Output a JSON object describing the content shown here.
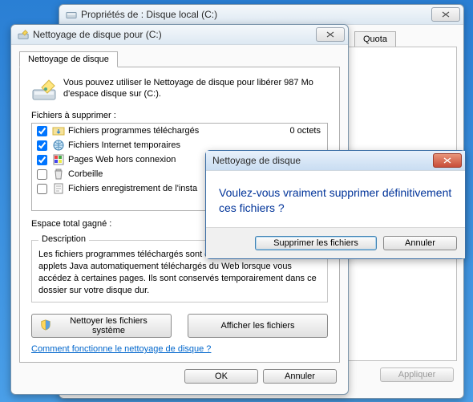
{
  "props_window": {
    "title": "Propriétés de : Disque local (C:)",
    "quota_tab": "Quota",
    "apply": "Appliquer"
  },
  "cleanup_window": {
    "title": "Nettoyage de disque pour  (C:)",
    "tab": "Nettoyage de disque",
    "info": "Vous pouvez utiliser le Nettoyage de disque pour libérer 987 Mo d'espace disque sur  (C:).",
    "files_to_delete": "Fichiers à supprimer :",
    "rows": [
      {
        "name": "Fichiers programmes téléchargés",
        "size": "0 octets",
        "checked": true
      },
      {
        "name": "Fichiers Internet temporaires",
        "size": "",
        "checked": true
      },
      {
        "name": "Pages Web hors connexion",
        "size": "",
        "checked": true
      },
      {
        "name": "Corbeille",
        "size": "",
        "checked": false
      },
      {
        "name": "Fichiers enregistrement de l'insta",
        "size": "",
        "checked": false
      }
    ],
    "total_space": "Espace total gagné :",
    "description_label": "Description",
    "description_text": "Les fichiers programmes téléchargés sont des contrôles ActiveX et des applets Java automatiquement téléchargés du Web lorsque vous accédez à certaines pages. Ils sont conservés temporairement dans ce dossier sur votre disque dur.",
    "clean_system": "Nettoyer les fichiers système",
    "view_files": "Afficher les fichiers",
    "how_link": "Comment fonctionne le nettoyage de disque ?",
    "ok": "OK",
    "cancel": "Annuler"
  },
  "confirm_dialog": {
    "title": "Nettoyage de disque",
    "message": "Voulez-vous vraiment supprimer définitivement ces fichiers ?",
    "delete": "Supprimer les fichiers",
    "cancel": "Annuler"
  }
}
